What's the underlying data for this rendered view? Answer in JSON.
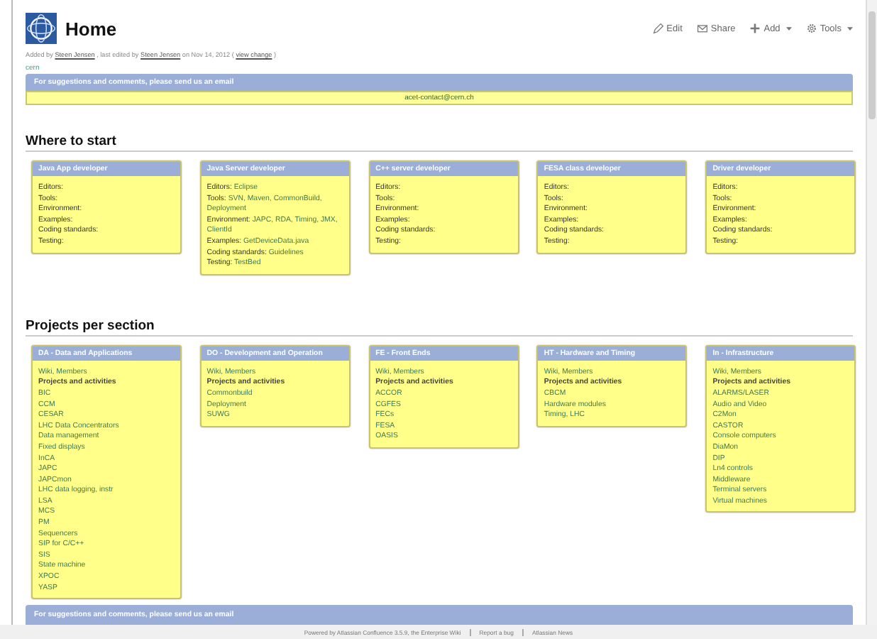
{
  "page": {
    "title": "Home",
    "byline": [
      {
        "kind": "text",
        "text": "Added by"
      },
      {
        "kind": "link",
        "text": "Steen Jensen"
      },
      {
        "kind": "text",
        "text": ", last edited by"
      },
      {
        "kind": "link",
        "text": "Steen Jensen"
      },
      {
        "kind": "text",
        "text": "on Nov 14, 2012  ("
      },
      {
        "kind": "link",
        "text": "view change"
      },
      {
        "kind": "text",
        "text": ")"
      }
    ],
    "label": "cern"
  },
  "actions": [
    {
      "label": "Edit",
      "dropdown": false
    },
    {
      "label": "Share",
      "dropdown": false
    },
    {
      "label": "Add",
      "dropdown": true
    },
    {
      "label": "Tools",
      "dropdown": true
    }
  ],
  "contact_top": {
    "title": "For suggestions and comments, please send us an email",
    "email": "acet-contact@cern.ch"
  },
  "sections": [
    {
      "heading": "Where to start",
      "kind": "roles",
      "boxes": [
        {
          "title": "Java App developer",
          "lines": [
            {
              "label": "Editors:"
            },
            {
              "label": "Tools:"
            },
            {
              "label": "Environment:"
            },
            {
              "label": "Examples:"
            },
            {
              "label": "Coding standards:"
            },
            {
              "label": "Testing:"
            }
          ]
        },
        {
          "title": "Java Server developer",
          "lines": [
            {
              "label": "Editors:",
              "value": "Eclipse"
            },
            {
              "label": "Tools:",
              "value": "SVN, Maven, CommonBuild, Deployment"
            },
            {
              "label": "Environment:",
              "value": "JAPC, RDA, Timing, JMX, ClientId"
            },
            {
              "label": "Examples:",
              "value": "GetDeviceData.java"
            },
            {
              "label": "Coding standards:",
              "value": "Guidelines"
            },
            {
              "label": "Testing:",
              "value": "TestBed"
            }
          ]
        },
        {
          "title": "C++ server developer",
          "lines": [
            {
              "label": "Editors:"
            },
            {
              "label": "Tools:"
            },
            {
              "label": "Environment:"
            },
            {
              "label": "Examples:"
            },
            {
              "label": "Coding standards:"
            },
            {
              "label": "Testing:"
            }
          ]
        },
        {
          "title": "FESA class developer",
          "lines": [
            {
              "label": "Editors:"
            },
            {
              "label": "Tools:"
            },
            {
              "label": "Environment:"
            },
            {
              "label": "Examples:"
            },
            {
              "label": "Coding standards:"
            },
            {
              "label": "Testing:"
            }
          ]
        },
        {
          "title": "Driver developer",
          "lines": [
            {
              "label": "Editors:"
            },
            {
              "label": "Tools:"
            },
            {
              "label": "Environment:"
            },
            {
              "label": "Examples:"
            },
            {
              "label": "Coding standards:"
            },
            {
              "label": "Testing:"
            }
          ]
        }
      ]
    },
    {
      "heading": "Projects per section",
      "kind": "projects",
      "boxes": [
        {
          "title": "DA - Data and Applications",
          "lines": [
            {
              "kind": "link",
              "text": "Wiki, Members"
            },
            {
              "kind": "heading",
              "text": "Projects and activities"
            },
            {
              "kind": "link",
              "text": "BIC"
            },
            {
              "kind": "link",
              "text": "CCM"
            },
            {
              "kind": "link",
              "text": "CESAR"
            },
            {
              "kind": "link",
              "text": "LHC Data Concentrators"
            },
            {
              "kind": "link",
              "text": "Data management"
            },
            {
              "kind": "link",
              "text": "Fixed displays"
            },
            {
              "kind": "link",
              "text": "InCA"
            },
            {
              "kind": "link",
              "text": "JAPC"
            },
            {
              "kind": "link",
              "text": "JAPCmon"
            },
            {
              "kind": "link",
              "text": "LHC data logging, instr"
            },
            {
              "kind": "link",
              "text": "LSA"
            },
            {
              "kind": "link",
              "text": "MCS"
            },
            {
              "kind": "link",
              "text": "PM"
            },
            {
              "kind": "link",
              "text": "Sequencers"
            },
            {
              "kind": "link",
              "text": "SIP for C/C++"
            },
            {
              "kind": "link",
              "text": "SIS"
            },
            {
              "kind": "link",
              "text": "State machine"
            },
            {
              "kind": "link",
              "text": "XPOC"
            },
            {
              "kind": "link",
              "text": "YASP"
            }
          ]
        },
        {
          "title": "DO - Development and Operation",
          "lines": [
            {
              "kind": "link",
              "text": "Wiki, Members"
            },
            {
              "kind": "heading",
              "text": "Projects and activities"
            },
            {
              "kind": "link",
              "text": "Commonbuild"
            },
            {
              "kind": "link",
              "text": "Deployment"
            },
            {
              "kind": "link",
              "text": "SUWG"
            }
          ]
        },
        {
          "title": "FE - Front Ends",
          "lines": [
            {
              "kind": "link",
              "text": "Wiki, Members"
            },
            {
              "kind": "heading",
              "text": "Projects and activities"
            },
            {
              "kind": "link",
              "text": "ACCOR"
            },
            {
              "kind": "link",
              "text": "CGFES"
            },
            {
              "kind": "link",
              "text": "FECs"
            },
            {
              "kind": "link",
              "text": "FESA"
            },
            {
              "kind": "link",
              "text": "OASIS"
            }
          ]
        },
        {
          "title": "HT - Hardware and Timing",
          "lines": [
            {
              "kind": "link",
              "text": "Wiki, Members"
            },
            {
              "kind": "heading",
              "text": "Projects and activities"
            },
            {
              "kind": "link",
              "text": "CBCM"
            },
            {
              "kind": "link",
              "text": "Hardware modules"
            },
            {
              "kind": "link",
              "text": "Timing, LHC"
            }
          ]
        },
        {
          "title": "In - Infrastructure",
          "lines": [
            {
              "kind": "link",
              "text": "Wiki, Members"
            },
            {
              "kind": "heading",
              "text": "Projects and activities"
            },
            {
              "kind": "link",
              "text": "ALARMS/LASER"
            },
            {
              "kind": "link",
              "text": "Audio and Video"
            },
            {
              "kind": "link",
              "text": "C2Mon"
            },
            {
              "kind": "link",
              "text": "CASTOR"
            },
            {
              "kind": "link",
              "text": "Console computers"
            },
            {
              "kind": "link",
              "text": "DiaMon"
            },
            {
              "kind": "link",
              "text": "DIP"
            },
            {
              "kind": "link",
              "text": "Ln4 controls"
            },
            {
              "kind": "link",
              "text": "Middleware"
            },
            {
              "kind": "link",
              "text": "Terminal servers"
            },
            {
              "kind": "link",
              "text": "Virtual machines"
            }
          ]
        }
      ]
    }
  ],
  "contact_bottom": {
    "title": "For suggestions and comments, please send us an email"
  },
  "footer": [
    "Powered by Atlassian Confluence 3.5.9, the Enterprise Wiki",
    "Report a bug",
    "Atlassian News"
  ]
}
